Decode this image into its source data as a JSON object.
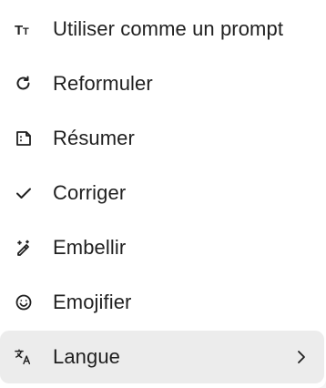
{
  "menu": {
    "items": [
      {
        "label": "Utiliser comme un prompt",
        "icon": "text-size-icon"
      },
      {
        "label": "Reformuler",
        "icon": "refresh-icon"
      },
      {
        "label": "Résumer",
        "icon": "summary-document-icon"
      },
      {
        "label": "Corriger",
        "icon": "checkmark-icon"
      },
      {
        "label": "Embellir",
        "icon": "magic-pen-icon"
      },
      {
        "label": "Emojifier",
        "icon": "smiley-icon"
      },
      {
        "label": "Langue",
        "icon": "translate-icon",
        "has_submenu": true,
        "submenu_icon": "chevron-right-icon",
        "highlighted": true
      }
    ]
  },
  "colors": {
    "text": "#1f1f1f",
    "background": "#ffffff",
    "highlight": "#ececec"
  }
}
